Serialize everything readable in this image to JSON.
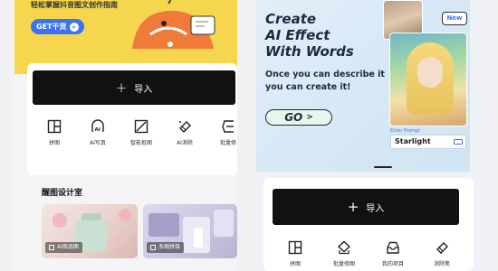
{
  "left": {
    "banner": {
      "subtitle": "轻松掌握抖音图文创作指南",
      "cta_label": "GET干货",
      "cta_arrow": "»"
    },
    "import_button": {
      "plus": "+",
      "label": "导入"
    },
    "tools": [
      {
        "label": "拼图",
        "icon": "grid-icon"
      },
      {
        "label": "AI写真",
        "icon": "ai-portrait-icon"
      },
      {
        "label": "智能抠图",
        "icon": "cutout-icon"
      },
      {
        "label": "AI消除",
        "icon": "eraser-icon"
      },
      {
        "label": "批量修",
        "icon": "batch-icon"
      }
    ],
    "section_title": "醒图设计室",
    "thumbs": [
      {
        "label": "AI商品图"
      },
      {
        "label": "多图拼接"
      }
    ]
  },
  "right": {
    "banner": {
      "title_lines": [
        "Create",
        "AI Effect",
        "With Words"
      ],
      "desc_lines": [
        "Once you can describe it",
        "you can create it!"
      ],
      "go_label": "GO",
      "go_arrow": ">",
      "new_badge": "New",
      "prompt_label": "Enter Prompt",
      "prompt_value": "Starlight"
    },
    "import_button": {
      "plus": "+",
      "label": "导入"
    },
    "tools": [
      {
        "label": "拼图",
        "icon": "grid-icon"
      },
      {
        "label": "批量修图",
        "icon": "batch-edit-icon"
      },
      {
        "label": "我的项目",
        "icon": "inbox-icon"
      },
      {
        "label": "消除笔",
        "icon": "eraser-icon"
      }
    ]
  },
  "colors": {
    "banner_yellow": "#f7d64f",
    "accent_blue": "#3a74f5",
    "import_black": "#111111"
  }
}
